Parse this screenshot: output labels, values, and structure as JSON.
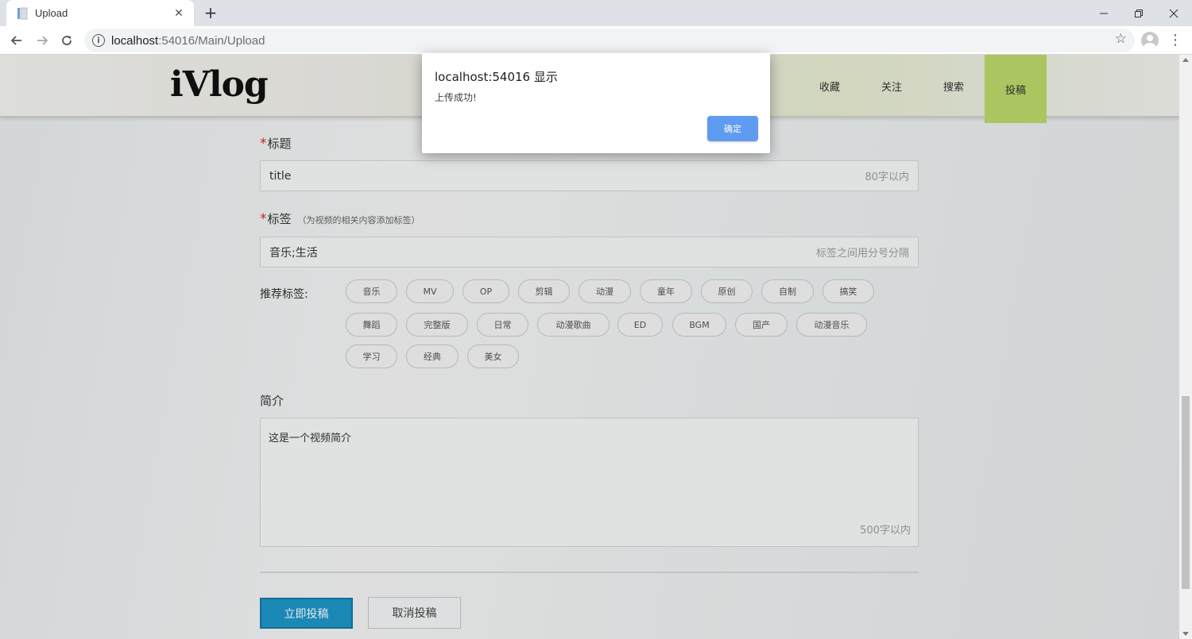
{
  "browser": {
    "tab_title": "Upload",
    "new_tab_glyph": "+",
    "tab_close_glyph": "✕",
    "url_host": "localhost",
    "url_rest": ":54016/Main/Upload",
    "icons": [
      "page-favicon-icon",
      "back-arrow-icon",
      "forward-arrow-icon",
      "reload-icon",
      "info-icon",
      "star-icon",
      "profile-avatar-icon",
      "kebab-menu-icon",
      "minimize-icon",
      "restore-icon",
      "close-icon"
    ]
  },
  "site": {
    "logo": "iVlog",
    "nav": [
      "收藏",
      "关注",
      "搜索",
      "投稿"
    ],
    "active_nav": "投稿",
    "colors": {
      "active_nav": "#bcd96a",
      "submit": "#1e96c8",
      "required": "#e0261d",
      "dialog_ok": "#5f9bf0"
    }
  },
  "form": {
    "required_mark": "*",
    "title_label": "标题",
    "title_value": "title",
    "title_limit": "80字以内",
    "tags_label": "标签",
    "tags_hint": "（为视频的相关内容添加标签）",
    "tags_value": "音乐;生活",
    "tags_placeholder_hint": "标签之间用分号分隔",
    "recommended_label": "推荐标签:",
    "recommended_tags": [
      [
        "音乐",
        "MV",
        "OP",
        "剪辑",
        "动漫",
        "童年",
        "原创",
        "自制",
        "搞笑"
      ],
      [
        "舞蹈",
        "完整版",
        "日常",
        "动漫歌曲",
        "ED",
        "BGM",
        "国产",
        "动漫音乐"
      ],
      [
        "学习",
        "经典",
        "美女"
      ]
    ],
    "summary_label": "简介",
    "summary_value": "这是一个视频简介",
    "summary_limit": "500字以内",
    "submit_label": "立即投稿",
    "cancel_label": "取消投稿"
  },
  "dialog": {
    "title": "localhost:54016 显示",
    "message": "上传成功!",
    "ok_label": "确定"
  }
}
